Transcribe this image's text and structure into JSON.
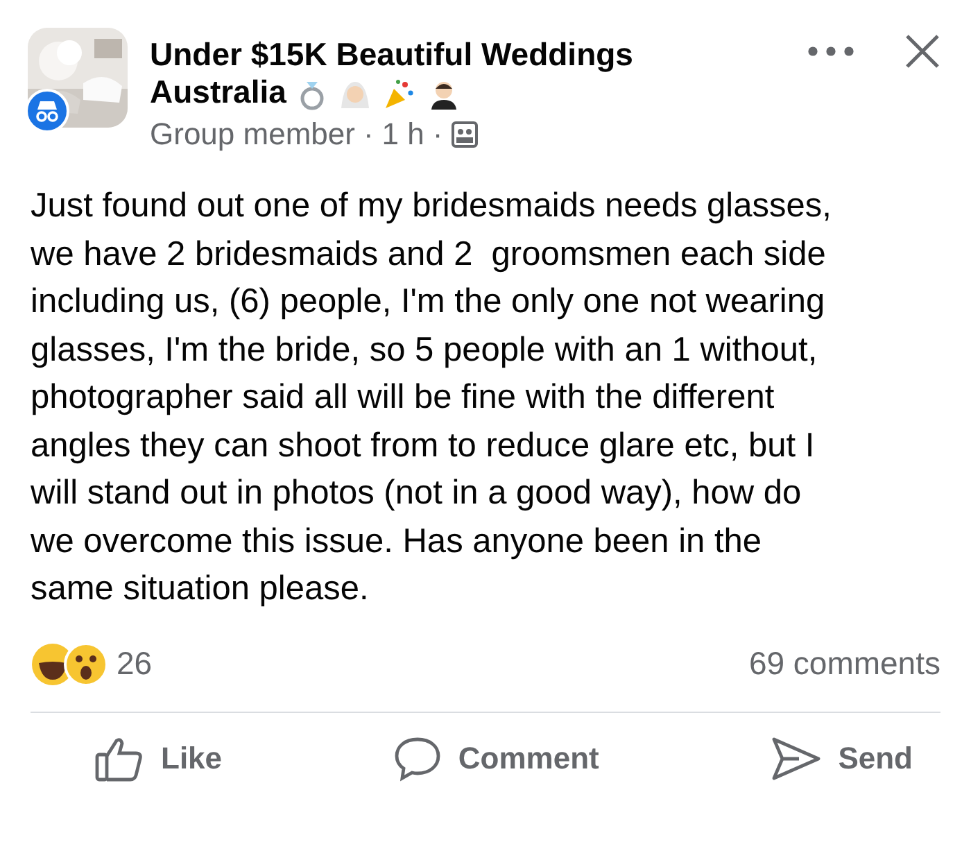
{
  "post": {
    "group_name": "Under $15K Beautiful Weddings Australia",
    "author_role": "Group member",
    "time": "1 h",
    "separator": "·",
    "body": "Just found out one of my bridesmaids needs glasses,\nwe have 2 bridesmaids and 2  groomsmen each side\nincluding us, (6) people, I'm the only one not wearing\nglasses, I'm the bride, so 5 people with an 1 without,\nphotographer said all will be fine with the different\nangles they can shoot from to reduce glare etc, but I\nwill stand out in photos (not in a good way), how do\nwe overcome this issue. Has anyone been in the\nsame situation please.",
    "reaction_count": "26",
    "comments": "69 comments"
  },
  "actions": [
    {
      "kind": "like",
      "label": "Like"
    },
    {
      "kind": "comment",
      "label": "Comment"
    },
    {
      "kind": "send",
      "label": "Send"
    }
  ]
}
